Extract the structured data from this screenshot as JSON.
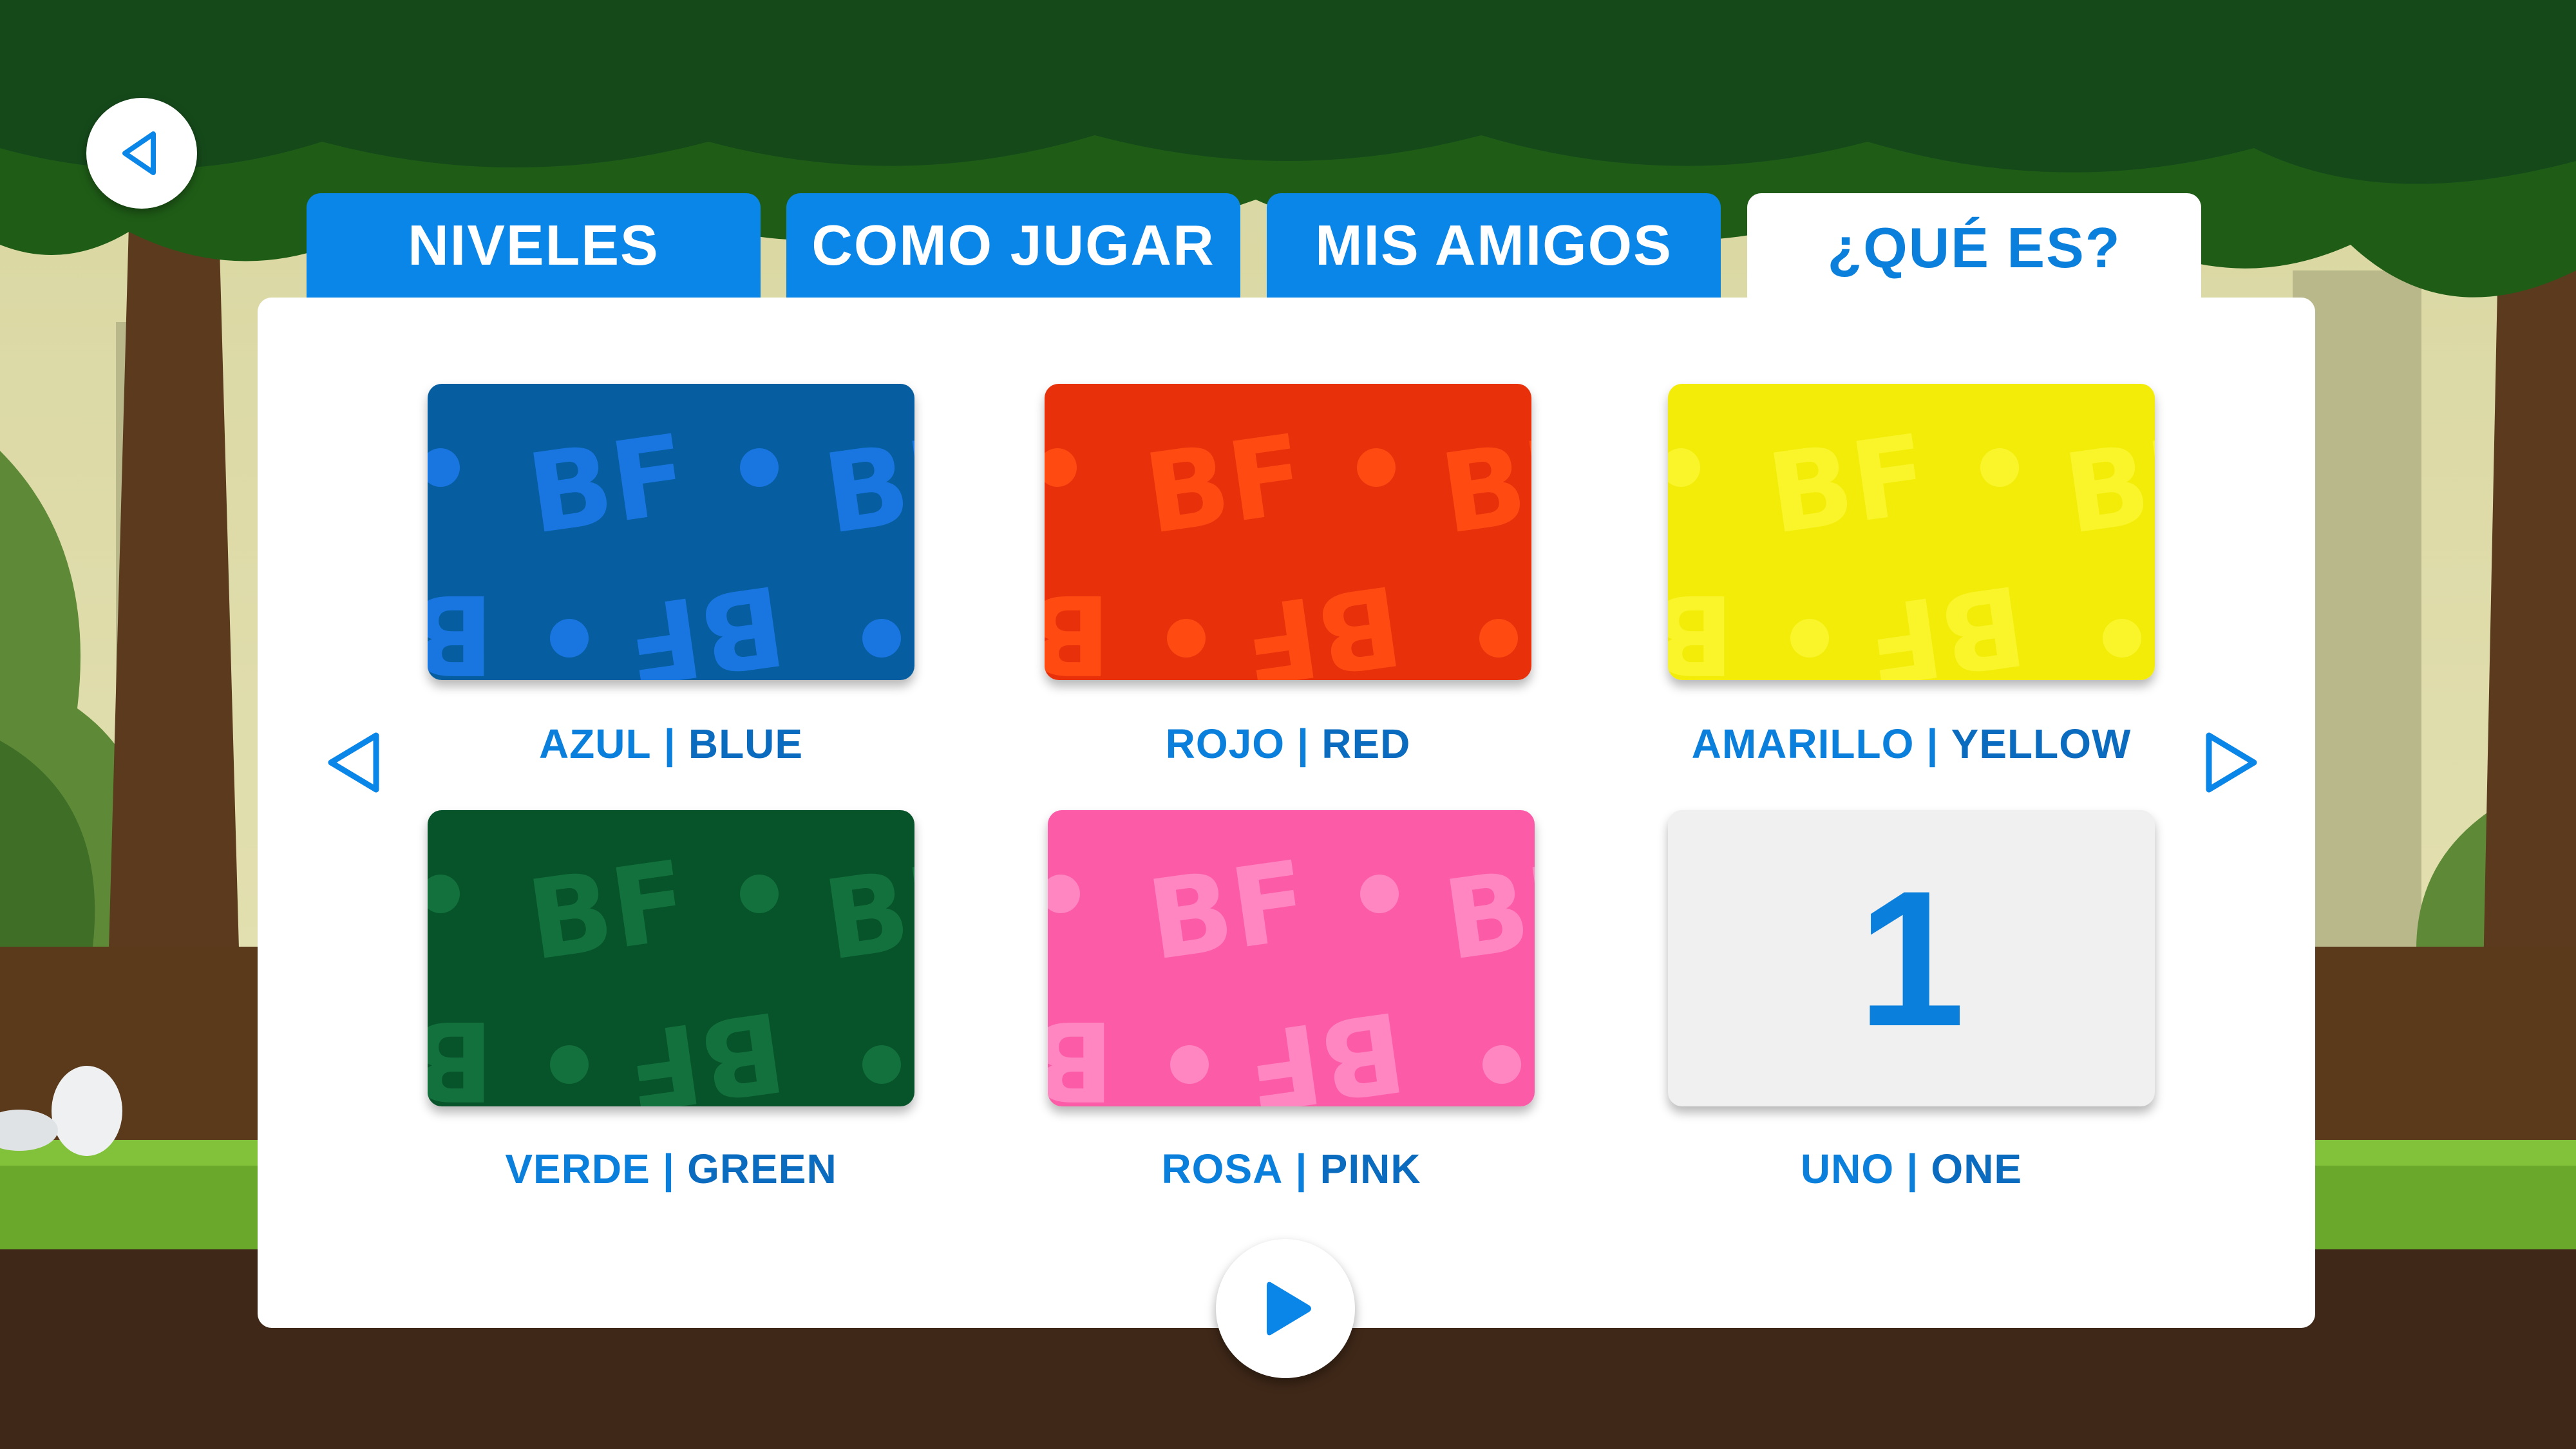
{
  "tabs": [
    {
      "label": "NIVELES",
      "active": false
    },
    {
      "label": "COMO JUGAR",
      "active": false
    },
    {
      "label": "MIS AMIGOS",
      "active": false
    },
    {
      "label": "¿QUÉ ES?",
      "active": true
    }
  ],
  "cards": [
    {
      "es": "AZUL",
      "en": "BLUE",
      "color": "#065da0",
      "pattern_color": "#1976e0",
      "pattern_text": "BF"
    },
    {
      "es": "ROJO",
      "en": "RED",
      "color": "#e8300a",
      "pattern_color": "#ff4a12",
      "pattern_text": "BF"
    },
    {
      "es": "AMARILLO",
      "en": "YELLOW",
      "color": "#f2ec08",
      "pattern_color": "#faf52a",
      "pattern_text": "BF"
    },
    {
      "es": "VERDE",
      "en": "GREEN",
      "color": "#07532a",
      "pattern_color": "#12713c",
      "pattern_text": "BF"
    },
    {
      "es": "ROSA",
      "en": "PINK",
      "color": "#fc5ba8",
      "pattern_color": "#ff86c0",
      "pattern_text": "BF"
    },
    {
      "es": "UNO",
      "en": "ONE",
      "number": "1",
      "color": "#f0f0f0"
    }
  ],
  "separator": "|",
  "colors": {
    "primary_blue": "#0a86e8",
    "label_blue": "#0a7fdc",
    "panel": "#ffffff"
  },
  "icons": {
    "back": "back-triangle-icon",
    "prev": "prev-arrow-icon",
    "next": "next-arrow-icon",
    "play": "play-icon"
  }
}
